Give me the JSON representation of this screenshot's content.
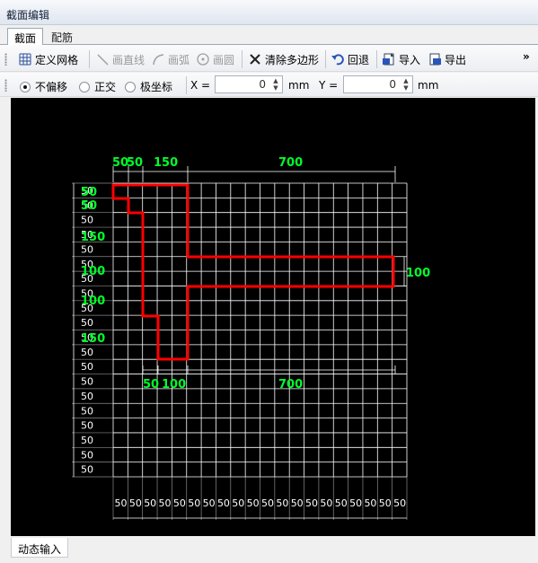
{
  "window": {
    "title": "截面编辑"
  },
  "tabs": [
    {
      "label": "截面",
      "active": true
    },
    {
      "label": "配筋",
      "active": false
    }
  ],
  "toolbar": {
    "define_grid": "定义网格",
    "draw_line": "画直线",
    "draw_arc": "画弧",
    "draw_circle": "画圆",
    "clear_polygon": "清除多边形",
    "undo": "回退",
    "import": "导入",
    "export": "导出",
    "more": "»"
  },
  "toolbar2": {
    "mode_none": "不偏移",
    "mode_ortho": "正交",
    "mode_polar": "极坐标",
    "x_label": "X =",
    "x_value": "0",
    "x_unit": "mm",
    "y_label": "Y =",
    "y_value": "0",
    "y_unit": "mm"
  },
  "status": {
    "tab_label": "动态输入"
  },
  "colors": {
    "grid": "#ffffff",
    "dimension_text": "#00ff2a",
    "section_outline": "#ff0000",
    "canvas_bg": "#000000"
  },
  "drawing": {
    "top_dims": [
      "50",
      "50",
      "150",
      "700"
    ],
    "right_dim": "100",
    "bottom_dims": [
      "50",
      "100",
      "700"
    ],
    "left_dims_green": [
      "50",
      "50",
      "150",
      "100",
      "100",
      "150"
    ],
    "row_labels": [
      "50",
      "50",
      "50",
      "50",
      "50",
      "50",
      "50",
      "50",
      "50",
      "50",
      "50",
      "50",
      "50",
      "50",
      "50",
      "50",
      "50",
      "50",
      "50",
      "50"
    ],
    "col_labels": [
      "50",
      "50",
      "50",
      "50",
      "50",
      "50",
      "50",
      "50",
      "50",
      "50",
      "50",
      "50",
      "50",
      "50",
      "50",
      "50",
      "50",
      "50",
      "50",
      "50"
    ]
  }
}
